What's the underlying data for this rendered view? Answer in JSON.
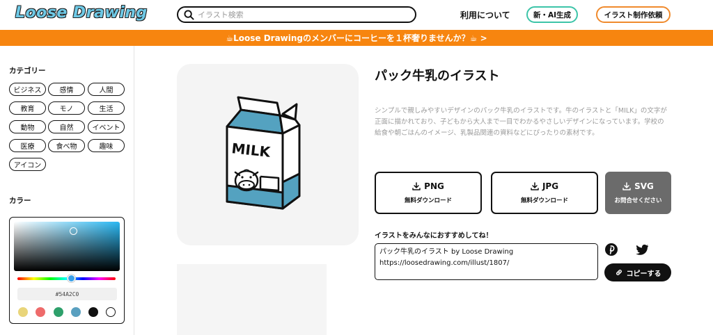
{
  "header": {
    "logo": "Loose Drawing",
    "search_placeholder": "イラスト検索",
    "about": "利用について",
    "ai_button": "新・AI生成",
    "order_button": "イラスト制作依頼"
  },
  "banner": {
    "text": "☕Loose Drawingのメンバーにコーヒーを１杯奢りませんか？☕ >"
  },
  "sidebar": {
    "category_heading": "カテゴリー",
    "categories": [
      "ビジネス",
      "感情",
      "人間",
      "教育",
      "モノ",
      "生活",
      "動物",
      "自然",
      "イベント",
      "医療",
      "食べ物",
      "趣味",
      "アイコン"
    ],
    "color_heading": "カラー",
    "hex_value": "#54A2C0",
    "swatches": [
      "#e9d57a",
      "#ee6b6b",
      "#2ea06b",
      "#5aa0c0",
      "#111111",
      "#ffffff"
    ]
  },
  "main": {
    "title": "パック牛乳のイラスト",
    "description": "シンプルで親しみやすいデザインのパック牛乳のイラストです。牛のイラストと「MILK」の文字が正面に描かれており、子どもから大人まで一目でわかるやさしいデザインになっています。学校の給食や朝ごはんのイメージ、乳製品関連の資料などにぴったりの素材です。",
    "illustration_text": "MILK",
    "downloads": [
      {
        "format": "PNG",
        "sub": "無料ダウンロード"
      },
      {
        "format": "JPG",
        "sub": "無料ダウンロード"
      },
      {
        "format": "SVG",
        "sub": "お問合せください"
      }
    ],
    "share_heading": "イラストをみんなにおすすめしてね！",
    "share_line1": "パック牛乳のイラスト by Loose Drawing",
    "share_line2": "https://loosedrawing.com/illust/1807/",
    "copy_label": "コピーする"
  }
}
